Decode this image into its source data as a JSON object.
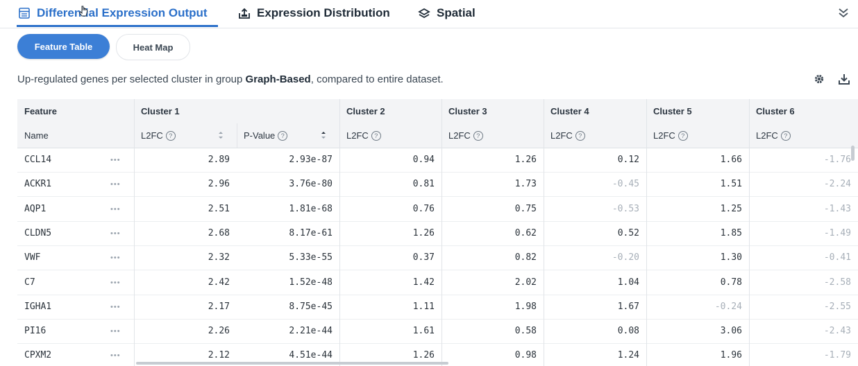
{
  "tabs": [
    {
      "label": "Differential Expression Output",
      "icon": "table-icon"
    },
    {
      "label": "Expression Distribution",
      "icon": "chart-upload-icon"
    },
    {
      "label": "Spatial",
      "icon": "layers-icon"
    }
  ],
  "subtabs": {
    "feature_table": "Feature Table",
    "heat_map": "Heat Map"
  },
  "description": {
    "prefix": "Up-regulated genes per selected cluster in group ",
    "group": "Graph-Based",
    "suffix": ", compared to entire dataset."
  },
  "table": {
    "group_headers": [
      "Feature",
      "Cluster 1",
      "Cluster 2",
      "Cluster 3",
      "Cluster 4",
      "Cluster 5",
      "Cluster 6"
    ],
    "sub_headers": [
      "Name",
      "L2FC",
      "P-Value",
      "L2FC",
      "L2FC",
      "L2FC",
      "L2FC",
      "L2FC"
    ],
    "rows": [
      {
        "name": "CCL14",
        "values": [
          "2.89",
          "2.93e-87",
          "0.94",
          "1.26",
          "0.12",
          "1.66",
          "-1.76"
        ]
      },
      {
        "name": "ACKR1",
        "values": [
          "2.96",
          "3.76e-80",
          "0.81",
          "1.73",
          "-0.45",
          "1.51",
          "-2.24"
        ]
      },
      {
        "name": "AQP1",
        "values": [
          "2.51",
          "1.81e-68",
          "0.76",
          "0.75",
          "-0.53",
          "1.25",
          "-1.43"
        ]
      },
      {
        "name": "CLDN5",
        "values": [
          "2.68",
          "8.17e-61",
          "1.26",
          "0.62",
          "0.52",
          "1.85",
          "-1.49"
        ]
      },
      {
        "name": "VWF",
        "values": [
          "2.32",
          "5.33e-55",
          "0.37",
          "0.82",
          "-0.20",
          "1.30",
          "-0.41"
        ]
      },
      {
        "name": "C7",
        "values": [
          "2.42",
          "1.52e-48",
          "1.42",
          "2.02",
          "1.04",
          "0.78",
          "-2.58"
        ]
      },
      {
        "name": "IGHA1",
        "values": [
          "2.17",
          "8.75e-45",
          "1.11",
          "1.98",
          "1.67",
          "-0.24",
          "-2.55"
        ]
      },
      {
        "name": "PI16",
        "values": [
          "2.26",
          "2.21e-44",
          "1.61",
          "0.58",
          "0.08",
          "3.06",
          "-2.43"
        ]
      },
      {
        "name": "CPXM2",
        "values": [
          "2.12",
          "4.51e-44",
          "1.26",
          "0.98",
          "1.24",
          "1.96",
          "-1.79"
        ]
      }
    ]
  },
  "colors": {
    "accent": "#2a6fc9",
    "pill_active": "#3c7fd6",
    "negative_text": "#a7afb8"
  }
}
